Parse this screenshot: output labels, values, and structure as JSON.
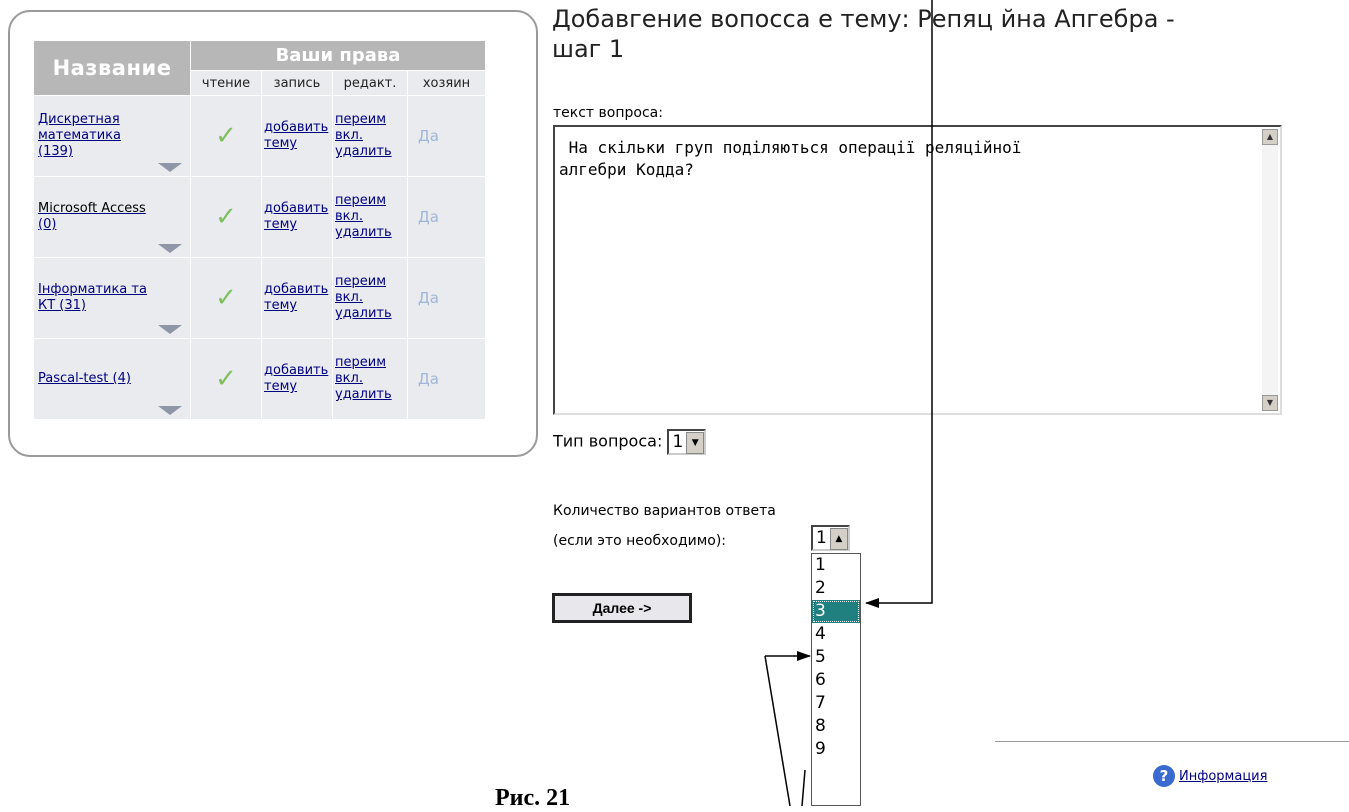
{
  "page_title_line1": "Добавгение вопосса е тему: Репяц йна Апгебра -",
  "page_title_line2": "шаг 1",
  "table": {
    "header_name": "Название",
    "header_rights": "Ваши права",
    "sub_headers": [
      "чтение",
      "запись",
      "редакт.",
      "хозяин"
    ],
    "rows": [
      {
        "name_lines": [
          "Дискретная",
          "математика",
          "(139)"
        ],
        "add": [
          "добавить",
          "тему"
        ],
        "edit": [
          "переим",
          "вкл.",
          "удалить"
        ],
        "owner": "Да"
      },
      {
        "name_lines": [
          "Microsoft Access",
          "(0)"
        ],
        "add": [
          "добавить",
          "тему"
        ],
        "edit": [
          "переим",
          "вкл.",
          "удалить"
        ],
        "owner": "Да"
      },
      {
        "name_lines": [
          "Інформатика та",
          "КТ (31)"
        ],
        "add": [
          "добавить",
          "тему"
        ],
        "edit": [
          "переим",
          "вкл.",
          "удалить"
        ],
        "owner": "Да"
      },
      {
        "name_lines": [
          "Pascal-test (4)"
        ],
        "add": [
          "добавить",
          "тему"
        ],
        "edit": [
          "переим",
          "вкл.",
          "удалить"
        ],
        "owner": "Да"
      }
    ]
  },
  "question": {
    "label": "текст вопроса:",
    "text_line1": " На скільки груп поділяються операції реляційної",
    "text_line2": "алгебри Кодда?"
  },
  "type_label": "Тип вопроса:",
  "type_value": "1",
  "count_label_line1": "Количество вариантов ответа",
  "count_label_line2": "(если это необходимо):",
  "count_value": "1",
  "next_button": "Далее ->",
  "dropdown_options": [
    "1",
    "2",
    "3",
    "4",
    "5",
    "6",
    "7",
    "8",
    "9"
  ],
  "dropdown_highlighted": "3",
  "info_link": "Информация",
  "caption": "Рис. 21"
}
